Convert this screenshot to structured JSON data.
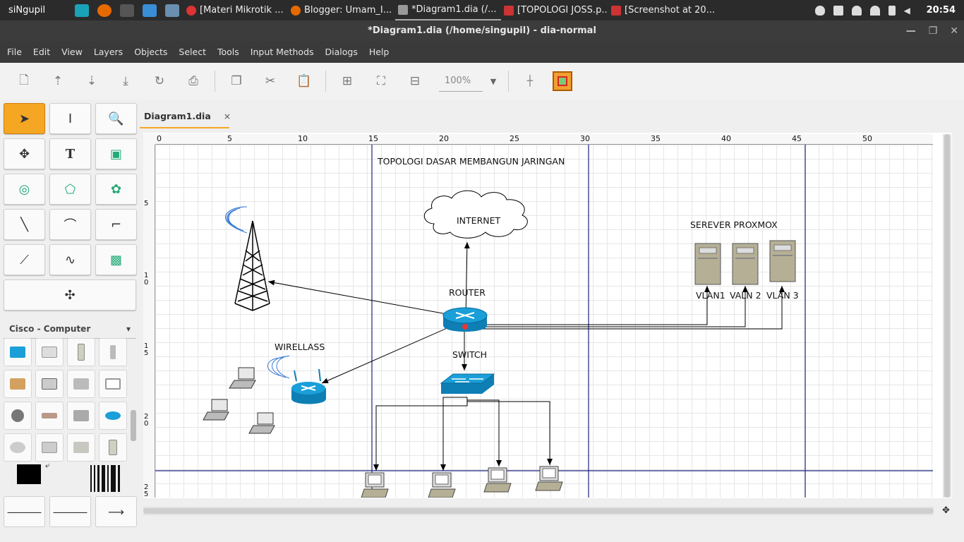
{
  "panel": {
    "app_name": "siNgupil",
    "tasks": [
      {
        "label": "[Materi Mikrotik ...",
        "color": "#d33"
      },
      {
        "label": "Blogger: Umam_I...",
        "color": "#e66a00"
      },
      {
        "label": "*Diagram1.dia (/...",
        "color": "#999"
      },
      {
        "label": "[TOPOLOGI JOSS.p...",
        "color": "#c33"
      },
      {
        "label": "[Screenshot at 20...",
        "color": "#c33"
      }
    ],
    "clock": "20:54"
  },
  "window": {
    "title": "*Diagram1.dia (/home/singupil) - dia-normal",
    "minimize": "—",
    "maximize": "❐",
    "close": "✕"
  },
  "menu": [
    "File",
    "Edit",
    "View",
    "Layers",
    "Objects",
    "Select",
    "Tools",
    "Input Methods",
    "Dialogs",
    "Help"
  ],
  "toolbar": {
    "zoom_value": "100%"
  },
  "toolbox": {
    "sheet": "Cisco - Computer"
  },
  "document": {
    "tab_label": "Diagram1.dia",
    "tab_close": "×"
  },
  "ruler": {
    "h_labels": [
      "0",
      "5",
      "10",
      "15",
      "20",
      "25",
      "30",
      "35",
      "40",
      "45",
      "50"
    ],
    "v_labels": [
      "5",
      "1\n0",
      "1\n5",
      "2\n0",
      "2\n5"
    ]
  },
  "diagram": {
    "title": "TOPOLOGI DASAR MEMBANGUN JARINGAN",
    "internet": "INTERNET",
    "router": "ROUTER",
    "switch": "SWITCH",
    "wireless": "WIRELLASS",
    "server_group": "SEREVER PROXMOX",
    "vlan1": "VLAN1",
    "vlan2": "VALN 2",
    "vlan3": "VLAN 3",
    "colors": {
      "device_blue": "#1a9fd8",
      "server_tan": "#b5b095",
      "guide_line": "#1a237e"
    }
  }
}
